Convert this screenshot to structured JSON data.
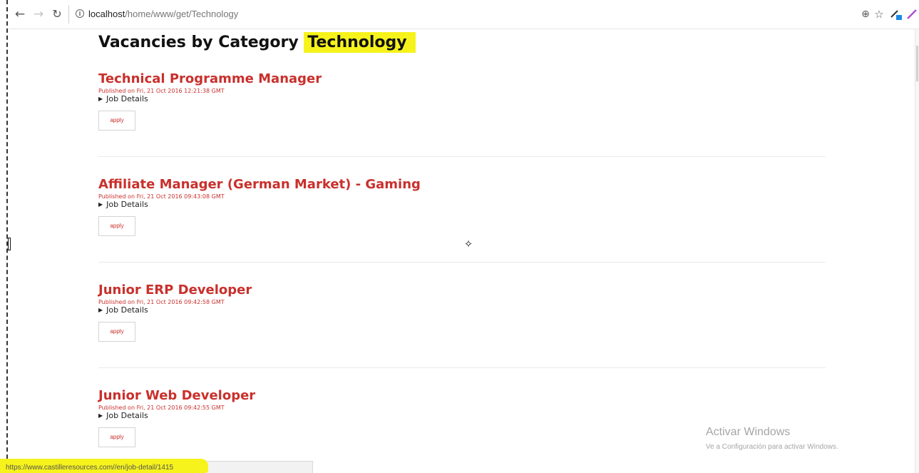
{
  "browser": {
    "url_host": "localhost",
    "url_path": "/home/www/get/Technology",
    "icons": {
      "back": "back-arrow-icon",
      "forward": "forward-arrow-icon",
      "reload": "reload-icon",
      "info": "info-icon",
      "zoom": "zoom-icon",
      "bookmark": "star-icon",
      "extension_pen": "pen-icon",
      "extension_brush": "brush-icon",
      "menu": "menu-icon"
    },
    "status_url": "https://www.castilleresources.com//en/job-detail/1415"
  },
  "page": {
    "title_prefix": "Vacancies by Category",
    "title_category": "Technology"
  },
  "vacancies": [
    {
      "title": "Technical Programme Manager",
      "published": "Published on Fri, 21 Oct 2016 12:21:38 GMT",
      "details_label": "Job Details",
      "apply_label": "apply"
    },
    {
      "title": "Affiliate Manager (German Market) - Gaming",
      "published": "Published on Fri, 21 Oct 2016 09:43:08 GMT",
      "details_label": "Job Details",
      "apply_label": "apply"
    },
    {
      "title": "Junior ERP Developer",
      "published": "Published on Fri, 21 Oct 2016 09:42:58 GMT",
      "details_label": "Job Details",
      "apply_label": "apply"
    },
    {
      "title": "Junior Web Developer",
      "published": "Published on Fri, 21 Oct 2016 09:42:55 GMT",
      "details_label": "Job Details",
      "apply_label": "apply"
    }
  ],
  "watermark": {
    "line1": "Activar Windows",
    "line2": "Ve a Configuración para activar Windows."
  },
  "colors": {
    "accent_red": "#c9302c",
    "highlight_yellow": "#f6f31c"
  }
}
